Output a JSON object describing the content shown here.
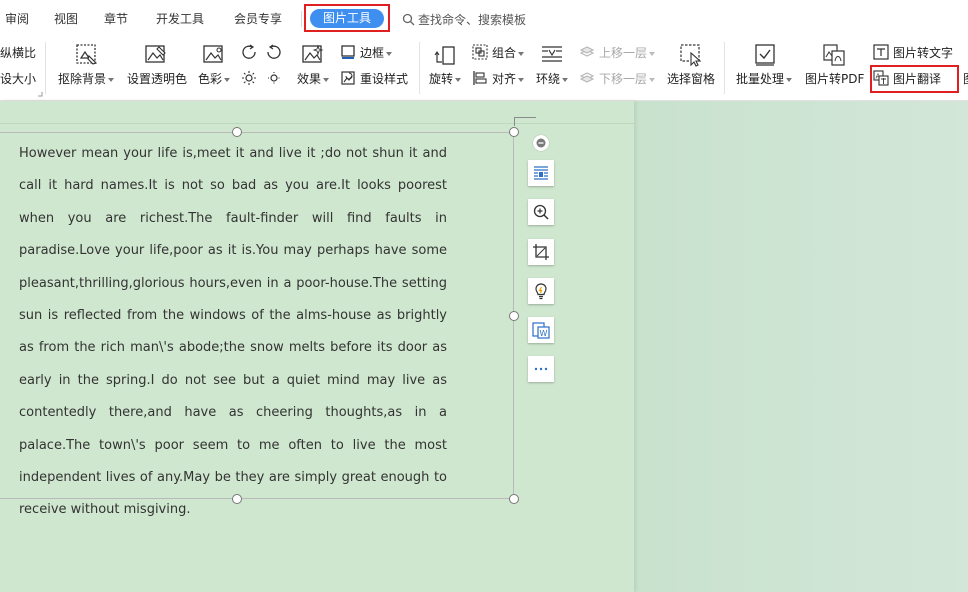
{
  "tabs": {
    "review": "审阅",
    "view": "视图",
    "chapter": "章节",
    "developer": "开发工具",
    "member": "会员专享",
    "picture_tools": "图片工具"
  },
  "search": {
    "placeholder": "查找命令、搜索模板"
  },
  "ribbon": {
    "crop_partial": "纵横比",
    "resize_partial": "设大小",
    "remove_bg": "抠除背景",
    "set_transparent": "设置透明色",
    "color": "色彩",
    "effects": "效果",
    "border": "边框",
    "reset_style": "重设样式",
    "rotate": "旋转",
    "combine": "组合",
    "align": "对齐",
    "wrap": "环绕",
    "bring_forward": "上移一层",
    "send_backward": "下移一层",
    "selection_pane": "选择窗格",
    "batch": "批量处理",
    "to_pdf": "图片转PDF",
    "to_text": "图片转文字",
    "translate": "图片翻译",
    "more_partial": "图"
  },
  "document": {
    "paragraph": "However mean your life is,meet it and live it ;do not shun it and call it hard names.It is not so bad as you are.It looks poorest when you are richest.The fault-finder will find faults in paradise.Love your life,poor as it is.You may perhaps have some pleasant,thrilling,glorious hours,even in a poor-house.The setting sun is reflected from the windows of the alms-house as brightly as from the rich man\\'s abode;the snow melts before its door as early in the spring.I do not see but a quiet mind may live as contentedly there,and have as cheering thoughts,as in a palace.The town\\'s poor seem to me often to live the most independent lives of any.May be they are simply great enough to receive without misgiving."
  },
  "floating_tools": {
    "icons": [
      "collapse-icon",
      "text-wrap-icon",
      "zoom-in-icon",
      "crop-icon",
      "idea-icon",
      "to-word-icon",
      "more-icon"
    ]
  },
  "colors": {
    "accent": "#3f8ff0",
    "highlight": "#e02020",
    "canvas": "#cfe7cf"
  }
}
